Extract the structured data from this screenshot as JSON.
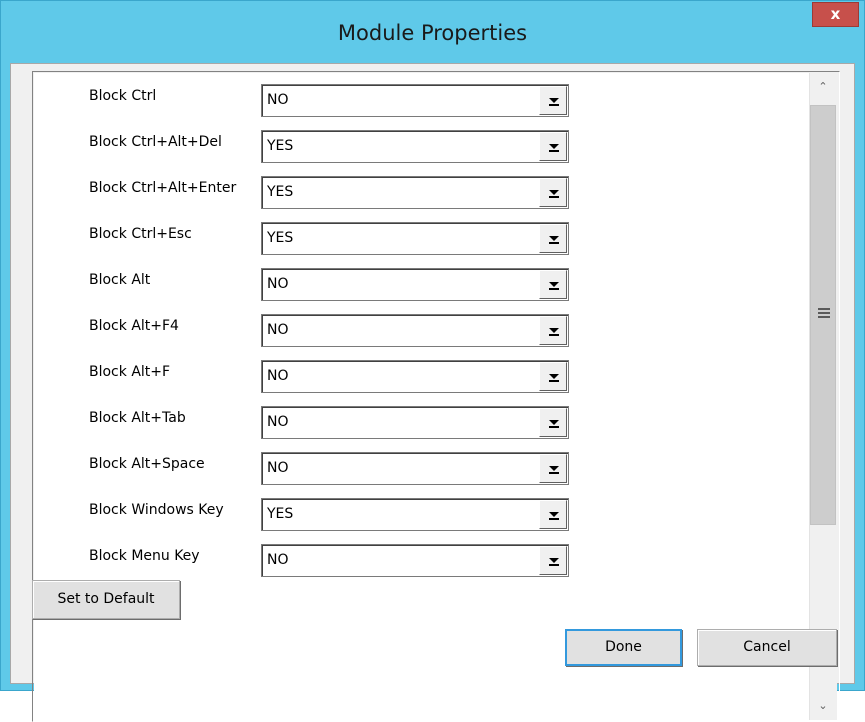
{
  "window": {
    "title": "Module Properties",
    "close_label": "x"
  },
  "properties": [
    {
      "label": "Block Ctrl",
      "value": "NO"
    },
    {
      "label": "Block Ctrl+Alt+Del",
      "value": "YES"
    },
    {
      "label": "Block Ctrl+Alt+Enter",
      "value": "YES"
    },
    {
      "label": "Block Ctrl+Esc",
      "value": "YES"
    },
    {
      "label": "Block Alt",
      "value": "NO"
    },
    {
      "label": "Block Alt+F4",
      "value": "NO"
    },
    {
      "label": "Block Alt+F",
      "value": "NO"
    },
    {
      "label": "Block Alt+Tab",
      "value": "NO"
    },
    {
      "label": "Block Alt+Space",
      "value": "NO"
    },
    {
      "label": "Block Windows Key",
      "value": "YES"
    },
    {
      "label": "Block Menu Key",
      "value": "NO"
    }
  ],
  "buttons": {
    "set_default": "Set to Default",
    "done": "Done",
    "cancel": "Cancel"
  },
  "colors": {
    "title_bar": "#5fc9e9",
    "close_button": "#c7504b",
    "dialog_background": "#f0f0f0"
  }
}
